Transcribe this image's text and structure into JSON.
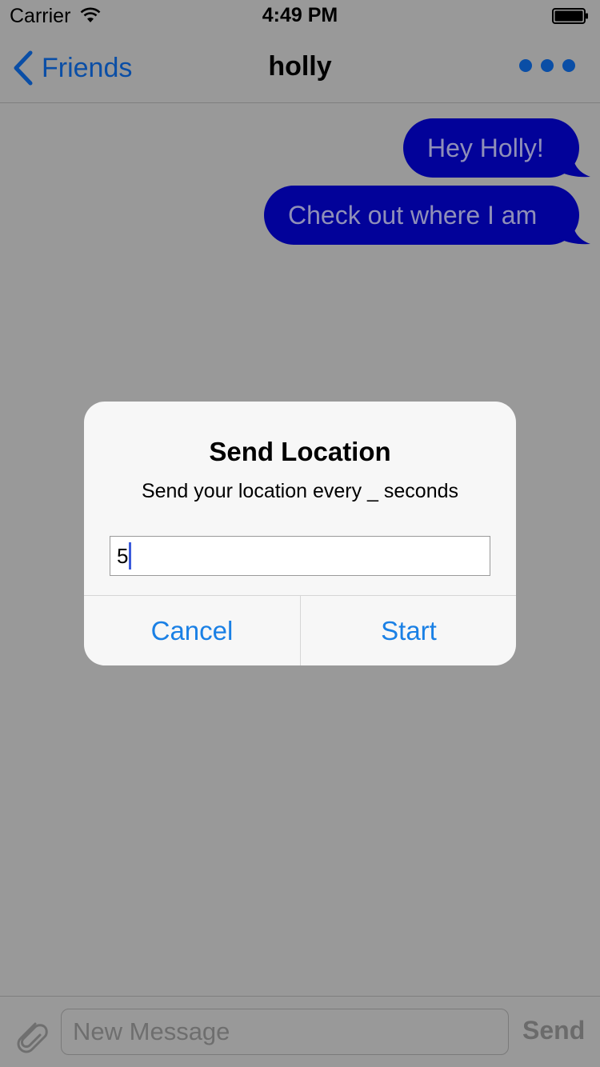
{
  "status_bar": {
    "carrier": "Carrier",
    "time": "4:49 PM"
  },
  "nav": {
    "back_label": "Friends",
    "title": "holly",
    "more_icon": "ellipsis-icon"
  },
  "messages": [
    {
      "text": "Hey Holly!"
    },
    {
      "text": "Check out where I am"
    }
  ],
  "alert": {
    "title": "Send Location",
    "message": "Send your location every _ seconds",
    "input_value": "5",
    "cancel_label": "Cancel",
    "start_label": "Start"
  },
  "composer": {
    "placeholder": "New Message",
    "send_label": "Send"
  },
  "colors": {
    "background": "#999999",
    "bubble": "#020299",
    "bubble_text": "#8f8fb8",
    "accent": "#1a80e5",
    "nav_accent": "#0a4ea6"
  }
}
